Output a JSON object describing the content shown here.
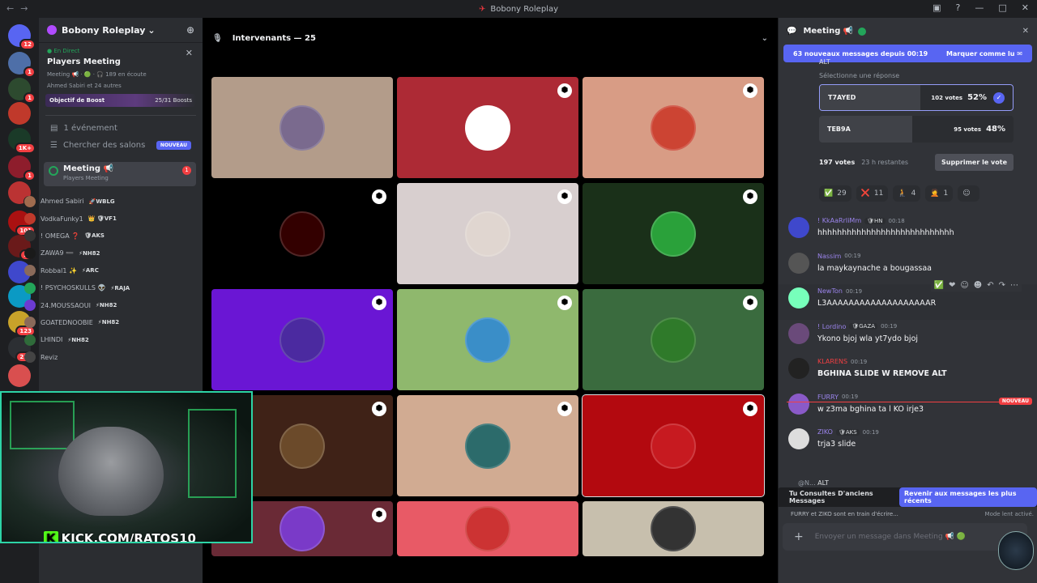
{
  "window": {
    "title": "Bobony Roleplay",
    "nav_back": "←",
    "nav_fwd": "→"
  },
  "rail": {
    "servers": [
      {
        "name": "discord-home",
        "badge": "12",
        "color": "#5865f2"
      },
      {
        "name": "server-1",
        "badge": "1",
        "color": "#4e6fa8"
      },
      {
        "name": "server-2",
        "badge": "1",
        "color": "#2d4a2f"
      },
      {
        "name": "server-3",
        "badge": "",
        "color": "#c0392b"
      },
      {
        "name": "server-4",
        "badge": "1K+",
        "color": "#1a3a28"
      },
      {
        "name": "server-5",
        "badge": "1",
        "color": "#8e1d2c"
      },
      {
        "name": "server-6",
        "badge": "2",
        "color": "#b33"
      },
      {
        "name": "server-7",
        "badge": "101",
        "color": "#a11"
      },
      {
        "name": "server-8",
        "badge": "56",
        "color": "#6a1a1a"
      },
      {
        "name": "server-9",
        "badge": "",
        "color": "#3f48cc"
      },
      {
        "name": "server-10",
        "badge": "",
        "color": "#0b9ac4"
      },
      {
        "name": "server-11",
        "badge": "123",
        "color": "#c8a22a"
      },
      {
        "name": "server-12",
        "badge": "211",
        "color": "#2c2f33"
      },
      {
        "name": "server-13",
        "badge": "",
        "color": "#d94f4f"
      }
    ]
  },
  "sidebar": {
    "server_name": "Bobony Roleplay",
    "live_label": "En Direct",
    "live_title": "Players Meeting",
    "live_meta": "Meeting 📢 · 🟢 · 🎧 189 en écoute",
    "live_attendees": "Ahmed Sabiri et 24 autres",
    "boost_label": "Objectif de Boost",
    "boost_value": "25/31 Boosts",
    "events": "1 événement",
    "search_channels": "Chercher des salons",
    "nouveau": "NOUVEAU",
    "channel_name": "Meeting 📢",
    "channel_sub": "Players Meeting",
    "channel_badge": "1",
    "users": [
      {
        "name": "Ahmed Sabiri",
        "tag": "🚀WBLG",
        "color": "#a06b4e"
      },
      {
        "name": "VodkaFunky1",
        "tag": "👑 🛡VF1",
        "color": "#c0392b"
      },
      {
        "name": "! OMEGA ❓",
        "tag": "🛡AKS",
        "color": "#333"
      },
      {
        "name": "ZAWA9 ➖",
        "tag": "⚡NH82",
        "color": "#1a1a1a"
      },
      {
        "name": "Robbal1 ✨",
        "tag": "⚡ARC",
        "color": "#8a6a5a"
      },
      {
        "name": "! PSYCHOSKULLS 👽",
        "tag": "⚡RAJA",
        "color": "#23a55a"
      },
      {
        "name": "24.MOUSSAOUI",
        "tag": "⚡NH82",
        "color": "#6c3bd1"
      },
      {
        "name": "GOATEDNOOBIE",
        "tag": "⚡NH82",
        "color": "#8a6a5a"
      },
      {
        "name": "LHINDI",
        "tag": "⚡NH82",
        "color": "#2f6b3a"
      },
      {
        "name": "Reviz",
        "tag": "",
        "color": "#444"
      }
    ]
  },
  "webcam": {
    "overlay": "KICK.COM/RATOS10"
  },
  "stage": {
    "header": "Intervenants — 25",
    "tiles": [
      {
        "bg": "#b39c8a",
        "av": "#7a6a8e",
        "shield": false,
        "sel": false
      },
      {
        "bg": "#ad2a35",
        "av": "#fff",
        "shield": true,
        "sel": false
      },
      {
        "bg": "#d89c85",
        "av": "#c43",
        "shield": true,
        "sel": false
      },
      {
        "bg": "#000000",
        "av": "#300",
        "shield": true,
        "sel": false
      },
      {
        "bg": "#d8cfcf",
        "av": "#e0d6d0",
        "shield": true,
        "sel": false
      },
      {
        "bg": "#1a3019",
        "av": "#2aa13a",
        "shield": true,
        "sel": false
      },
      {
        "bg": "#6a16d4",
        "av": "#4b2aa0",
        "shield": true,
        "sel": false
      },
      {
        "bg": "#8fb86d",
        "av": "#3a8ec8",
        "shield": true,
        "sel": false
      },
      {
        "bg": "#3a6b3e",
        "av": "#2f7a2a",
        "shield": true,
        "sel": false
      },
      {
        "bg": "#3f2217",
        "av": "#6b4a2a",
        "shield": true,
        "sel": false
      },
      {
        "bg": "#d1ab92",
        "av": "#2c6b6b",
        "shield": true,
        "sel": false
      },
      {
        "bg": "#b3090f",
        "av": "#c71a20",
        "shield": true,
        "sel": true
      },
      {
        "bg": "#6a2a36",
        "av": "#7a3ac8",
        "shield": true,
        "sel": false
      },
      {
        "bg": "#e85a66",
        "av": "#c33",
        "shield": false,
        "sel": false
      },
      {
        "bg": "#c7bfad",
        "av": "#333",
        "shield": false,
        "sel": false
      }
    ]
  },
  "chat": {
    "channel": "Meeting 📢",
    "new_bar": "63 nouveaux messages depuis 00:19",
    "mark_read": "Marquer comme lu",
    "poll": {
      "top": "ALT",
      "question": "Sélectionne une réponse",
      "options": [
        {
          "label": "T7AYED",
          "votes": "102 votes",
          "pct": "52%",
          "frac": 0.52,
          "selected": true
        },
        {
          "label": "TEB9A",
          "votes": "95 votes",
          "pct": "48%",
          "frac": 0.48,
          "selected": false
        }
      ],
      "total": "197 votes",
      "remaining": "23 h restantes",
      "remove": "Supprimer le vote"
    },
    "reactions": [
      {
        "e": "✅",
        "n": "29"
      },
      {
        "e": "❌",
        "n": "11"
      },
      {
        "e": "🧎",
        "n": "4"
      },
      {
        "e": "🤦",
        "n": "1"
      },
      {
        "e": "☺",
        "n": ""
      }
    ],
    "messages": [
      {
        "name": "! KkAaRrIiMm",
        "tag": "🛡HN",
        "time": "00:18",
        "text": "hhhhhhhhhhhhhhhhhhhhhhhhhhhh",
        "color": "#9b84ec",
        "av": "#3f48cc",
        "bold": false,
        "hov": false
      },
      {
        "name": "Nassim",
        "time": "00:19",
        "text": "la maykaynache a bougassaa",
        "color": "#9b84ec",
        "av": "#555",
        "bold": false,
        "hov": false
      },
      {
        "name": "NewTon",
        "time": "00:19",
        "text": "L3AAAAAAAAAAAAAAAAAAAR",
        "color": "#9b84ec",
        "av": "#7fb",
        "bold": false,
        "hov": true
      },
      {
        "name": "! Lordino",
        "tag": "🛡GAZA",
        "time": "00:19",
        "text": "Ykono bjoj wla yt7ydo bjoj",
        "color": "#9b84ec",
        "av": "#6a4a7a",
        "bold": false,
        "hov": false
      },
      {
        "name": "KLARENS",
        "time": "00:19",
        "text": "BGHINA SLIDE W REMOVE ALT",
        "color": "#f23f42",
        "av": "#222",
        "bold": true,
        "hov": false
      },
      {
        "name": "FURRY",
        "time": "00:19",
        "text": "w z3ma bghina ta l KO irje3",
        "color": "#9b84ec",
        "av": "#8a5ac8",
        "bold": false,
        "hov": false
      },
      {
        "name": "ZIKO",
        "tag": "🛡AKS",
        "time": "00:19",
        "text": "trja3 slide",
        "color": "#9b84ec",
        "av": "#ddd",
        "bold": false,
        "hov": false
      }
    ],
    "nouveau": "NOUVEAU",
    "reply_name": "@N...",
    "reply_text": "ALT",
    "old_msgs": "Tu Consultes D'anciens Messages",
    "jump_recent": "Revenir aux messages les plus récents",
    "typing": "FURRY et ZIKO sont en train d'écrire...",
    "slow_mode": "Mode lent activé.",
    "input_placeholder": "Envoyer un message dans Meeting 📢 🟢"
  }
}
